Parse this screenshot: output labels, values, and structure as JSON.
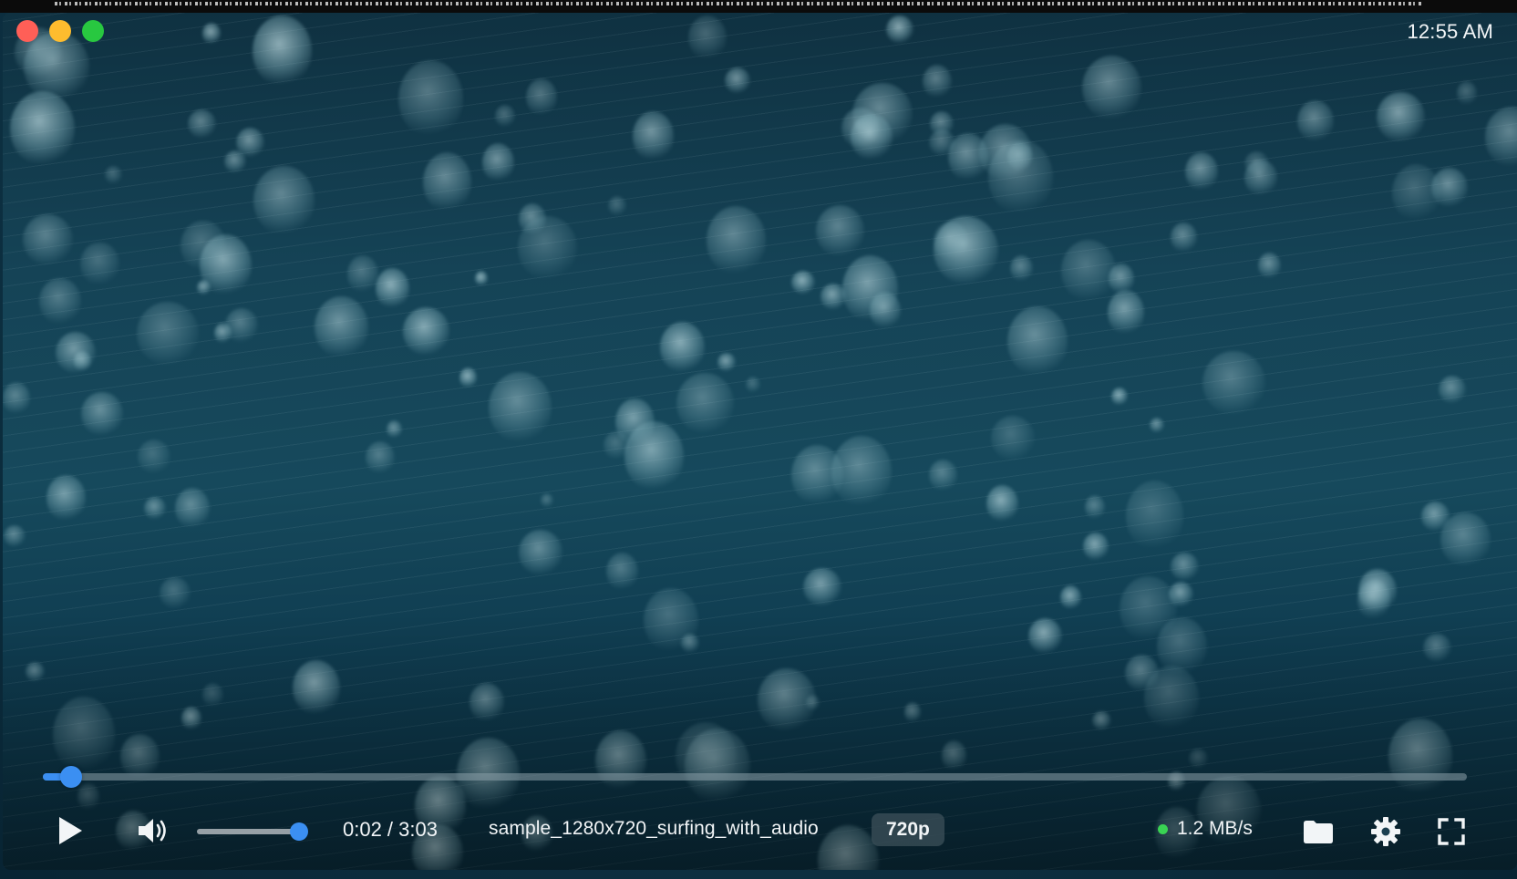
{
  "window": {
    "clock": "12:55 AM"
  },
  "player": {
    "progress_fraction": 0.011,
    "volume_fraction": 1.0,
    "time_display": "0:02 / 3:03",
    "filename": "sample_1280x720_surfing_with_audio",
    "quality": "720p",
    "download_speed": "1.2 MB/s",
    "status_dot_color": "#39d353",
    "accent_color": "#3b8ff2"
  },
  "icons": {
    "play": "play-icon",
    "volume": "volume-icon",
    "folder": "folder-icon",
    "settings": "gear-icon",
    "fullscreen": "fullscreen-icon"
  }
}
